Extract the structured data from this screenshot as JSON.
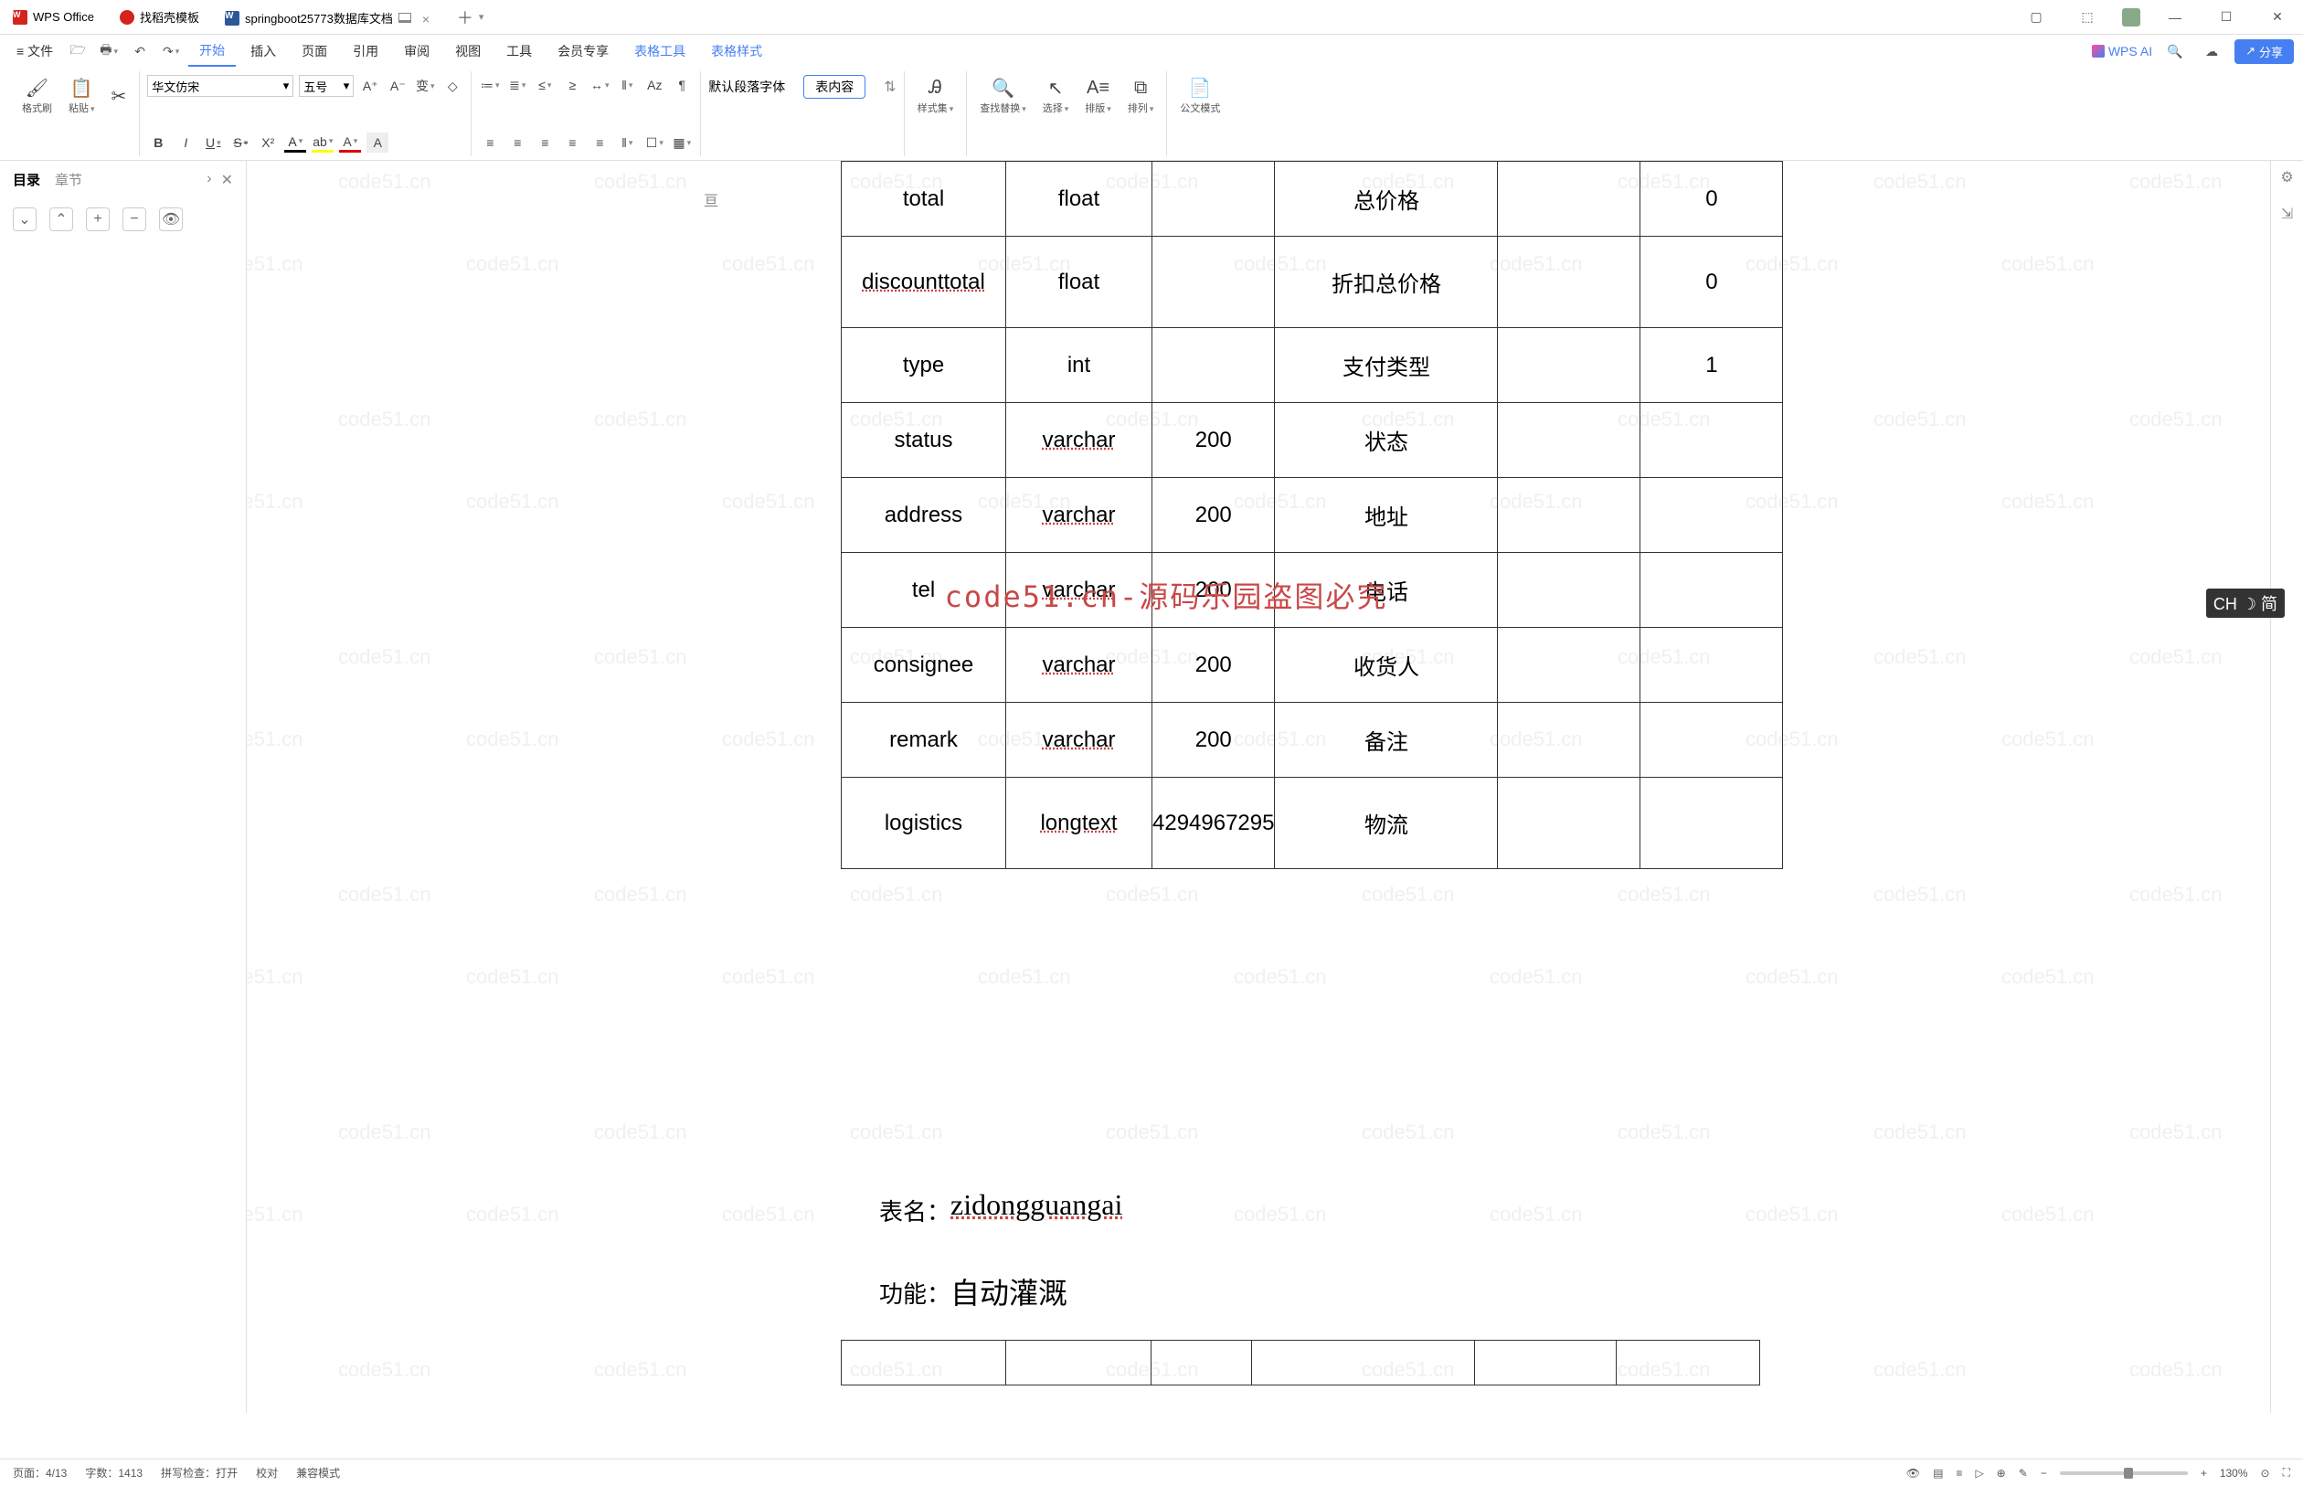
{
  "titlebar": {
    "app": "WPS Office",
    "tab2": "找稻壳模板",
    "tab3": "springboot25773数据库文档",
    "addDrop": "▾"
  },
  "menu": {
    "file": "文件",
    "items": [
      "开始",
      "插入",
      "页面",
      "引用",
      "审阅",
      "视图",
      "工具",
      "会员专享",
      "表格工具",
      "表格样式"
    ],
    "wpsai": "WPS AI",
    "share": "分享"
  },
  "ribbon": {
    "format_brush": "格式刷",
    "paste": "粘贴",
    "font": "华文仿宋",
    "size": "五号",
    "default_para": "默认段落字体",
    "table_content": "表内容",
    "style_set": "样式集",
    "find_replace": "查找替换",
    "select": "选择",
    "arrange1": "排版",
    "arrange2": "排列",
    "gov_mode": "公文模式"
  },
  "sidepanel": {
    "toc": "目录",
    "chapter": "章节"
  },
  "table": {
    "rows": [
      {
        "c1": "total",
        "c2": "float",
        "c3": "",
        "c4": "总价格",
        "c5": "",
        "c6": "0",
        "under2": false
      },
      {
        "c1": "discounttotal",
        "c2": "float",
        "c3": "",
        "c4": "折扣总价格",
        "c5": "",
        "c6": "0",
        "under1": true,
        "tall": true
      },
      {
        "c1": "type",
        "c2": "int",
        "c3": "",
        "c4": "支付类型",
        "c5": "",
        "c6": "1"
      },
      {
        "c1": "status",
        "c2": "varchar",
        "c3": "200",
        "c4": "状态",
        "c5": "",
        "c6": "",
        "under2": true
      },
      {
        "c1": "address",
        "c2": "varchar",
        "c3": "200",
        "c4": "地址",
        "c5": "",
        "c6": "",
        "under2": true
      },
      {
        "c1": "tel",
        "c2": "varchar",
        "c3": "200",
        "c4": "电话",
        "c5": "",
        "c6": "",
        "under2": true
      },
      {
        "c1": "consignee",
        "c2": "varchar",
        "c3": "200",
        "c4": "收货人",
        "c5": "",
        "c6": "",
        "under2": true
      },
      {
        "c1": "remark",
        "c2": "varchar",
        "c3": "200",
        "c4": "备注",
        "c5": "",
        "c6": "",
        "under2": true
      },
      {
        "c1": "logistics",
        "c2": "longtext",
        "c3": "4294967295",
        "c4": "物流",
        "c5": "",
        "c6": "",
        "under2": true,
        "tall": true
      }
    ]
  },
  "ruler_marker": "亘",
  "section": {
    "table_label": "表名：",
    "table_name": "zidongguangai",
    "func_label": "功能：",
    "func_name": "自动灌溉"
  },
  "watermark_text": "code51.cn",
  "center_watermark": "code51.cn-源码乐园盗图必究",
  "ime": "CH ☽ 简",
  "status": {
    "page": "页面：4/13",
    "words": "字数：1413",
    "spell": "拼写检查：打开",
    "proof": "校对",
    "compat": "兼容模式",
    "zoom": "130%"
  }
}
